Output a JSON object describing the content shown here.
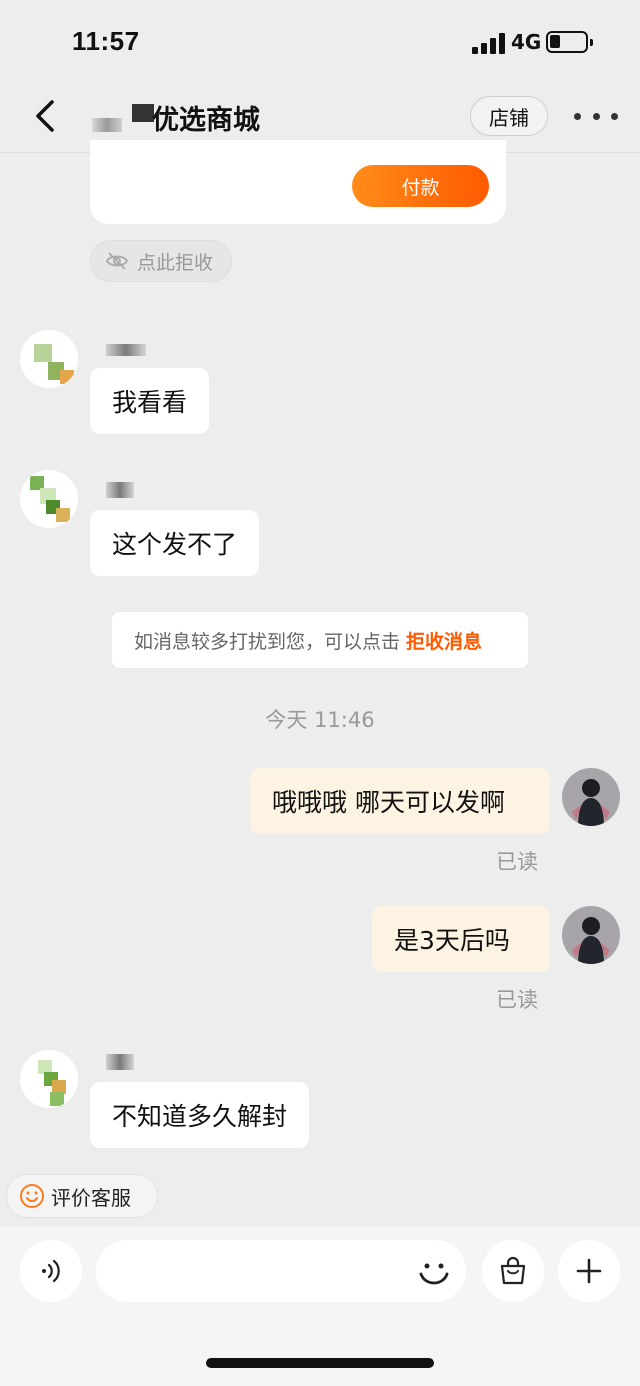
{
  "status_bar": {
    "time": "11:57",
    "network": "4G"
  },
  "nav": {
    "title": "优选商城",
    "store_label": "店铺"
  },
  "order_card": {
    "pay_label": "付款"
  },
  "reject_pill": {
    "label": "点此拒收"
  },
  "messages": [
    {
      "side": "left",
      "text": "我看看"
    },
    {
      "side": "left",
      "text": "这个发不了"
    },
    {
      "side": "right",
      "text": "哦哦哦 哪天可以发啊",
      "read": "已读"
    },
    {
      "side": "right",
      "text": "是3天后吗",
      "read": "已读"
    },
    {
      "side": "left",
      "text": "不知道多久解封"
    }
  ],
  "notice": {
    "text": "如消息较多打扰到您，可以点击",
    "link": "拒收消息"
  },
  "timestamp": "今天 11:46",
  "rate_pill": {
    "label": "评价客服"
  },
  "colors": {
    "accent": "#ff5a00",
    "my_bubble": "#fdf3e2",
    "background": "#ededed"
  },
  "icons": [
    "back-icon",
    "more-icon",
    "eye-off-icon",
    "smiley-icon",
    "voice-icon",
    "emoji-icon",
    "shopping-bag-icon",
    "plus-icon"
  ]
}
